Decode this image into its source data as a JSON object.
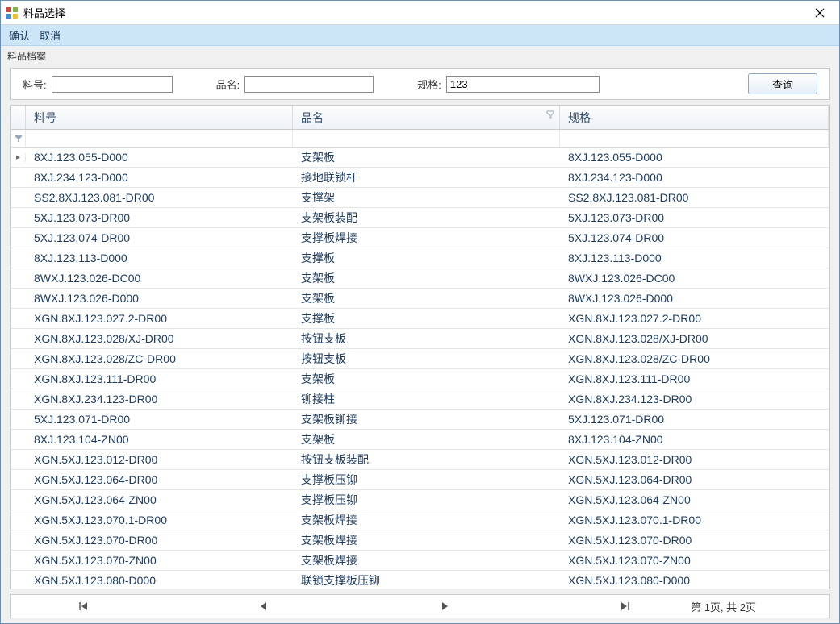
{
  "window": {
    "title": "料品选择"
  },
  "menu": {
    "confirm": "确认",
    "cancel": "取消"
  },
  "section": {
    "label": "料品档案"
  },
  "filters": {
    "code_label": "料号:",
    "name_label": "品名:",
    "spec_label": "规格:",
    "code_value": "",
    "name_value": "",
    "spec_value": "123",
    "query_label": "查询"
  },
  "grid": {
    "columns": {
      "code": "料号",
      "name": "品名",
      "spec": "规格"
    },
    "rows": [
      {
        "code": "8XJ.123.055-D000",
        "name": "支架板",
        "spec": "8XJ.123.055-D000"
      },
      {
        "code": "8XJ.234.123-D000",
        "name": "接地联锁杆",
        "spec": "8XJ.234.123-D000"
      },
      {
        "code": "SS2.8XJ.123.081-DR00",
        "name": "支撑架",
        "spec": "SS2.8XJ.123.081-DR00"
      },
      {
        "code": "5XJ.123.073-DR00",
        "name": "支架板装配",
        "spec": "5XJ.123.073-DR00"
      },
      {
        "code": "5XJ.123.074-DR00",
        "name": "支撑板焊接",
        "spec": "5XJ.123.074-DR00"
      },
      {
        "code": "8XJ.123.113-D000",
        "name": "支撑板",
        "spec": "8XJ.123.113-D000"
      },
      {
        "code": "8WXJ.123.026-DC00",
        "name": "支架板",
        "spec": "8WXJ.123.026-DC00"
      },
      {
        "code": "8WXJ.123.026-D000",
        "name": "支架板",
        "spec": "8WXJ.123.026-D000"
      },
      {
        "code": "XGN.8XJ.123.027.2-DR00",
        "name": "支撑板",
        "spec": "XGN.8XJ.123.027.2-DR00"
      },
      {
        "code": "XGN.8XJ.123.028/XJ-DR00",
        "name": "按钮支板",
        "spec": "XGN.8XJ.123.028/XJ-DR00"
      },
      {
        "code": "XGN.8XJ.123.028/ZC-DR00",
        "name": "按钮支板",
        "spec": "XGN.8XJ.123.028/ZC-DR00"
      },
      {
        "code": "XGN.8XJ.123.111-DR00",
        "name": "支架板",
        "spec": "XGN.8XJ.123.111-DR00"
      },
      {
        "code": "XGN.8XJ.234.123-DR00",
        "name": "铆接柱",
        "spec": "XGN.8XJ.234.123-DR00"
      },
      {
        "code": "5XJ.123.071-DR00",
        "name": "支架板铆接",
        "spec": "5XJ.123.071-DR00"
      },
      {
        "code": "8XJ.123.104-ZN00",
        "name": "支架板",
        "spec": "8XJ.123.104-ZN00"
      },
      {
        "code": "XGN.5XJ.123.012-DR00",
        "name": "按钮支板装配",
        "spec": "XGN.5XJ.123.012-DR00"
      },
      {
        "code": "XGN.5XJ.123.064-DR00",
        "name": "支撑板压铆",
        "spec": "XGN.5XJ.123.064-DR00"
      },
      {
        "code": "XGN.5XJ.123.064-ZN00",
        "name": "支撑板压铆",
        "spec": "XGN.5XJ.123.064-ZN00"
      },
      {
        "code": "XGN.5XJ.123.070.1-DR00",
        "name": "支架板焊接",
        "spec": "XGN.5XJ.123.070.1-DR00"
      },
      {
        "code": "XGN.5XJ.123.070-DR00",
        "name": "支架板焊接",
        "spec": "XGN.5XJ.123.070-DR00"
      },
      {
        "code": "XGN.5XJ.123.070-ZN00",
        "name": "支架板焊接",
        "spec": "XGN.5XJ.123.070-ZN00"
      },
      {
        "code": "XGN.5XJ.123.080-D000",
        "name": "联锁支撑板压铆",
        "spec": "XGN.5XJ.123.080-D000"
      }
    ]
  },
  "paginator": {
    "text": "第 1页, 共 2页"
  }
}
